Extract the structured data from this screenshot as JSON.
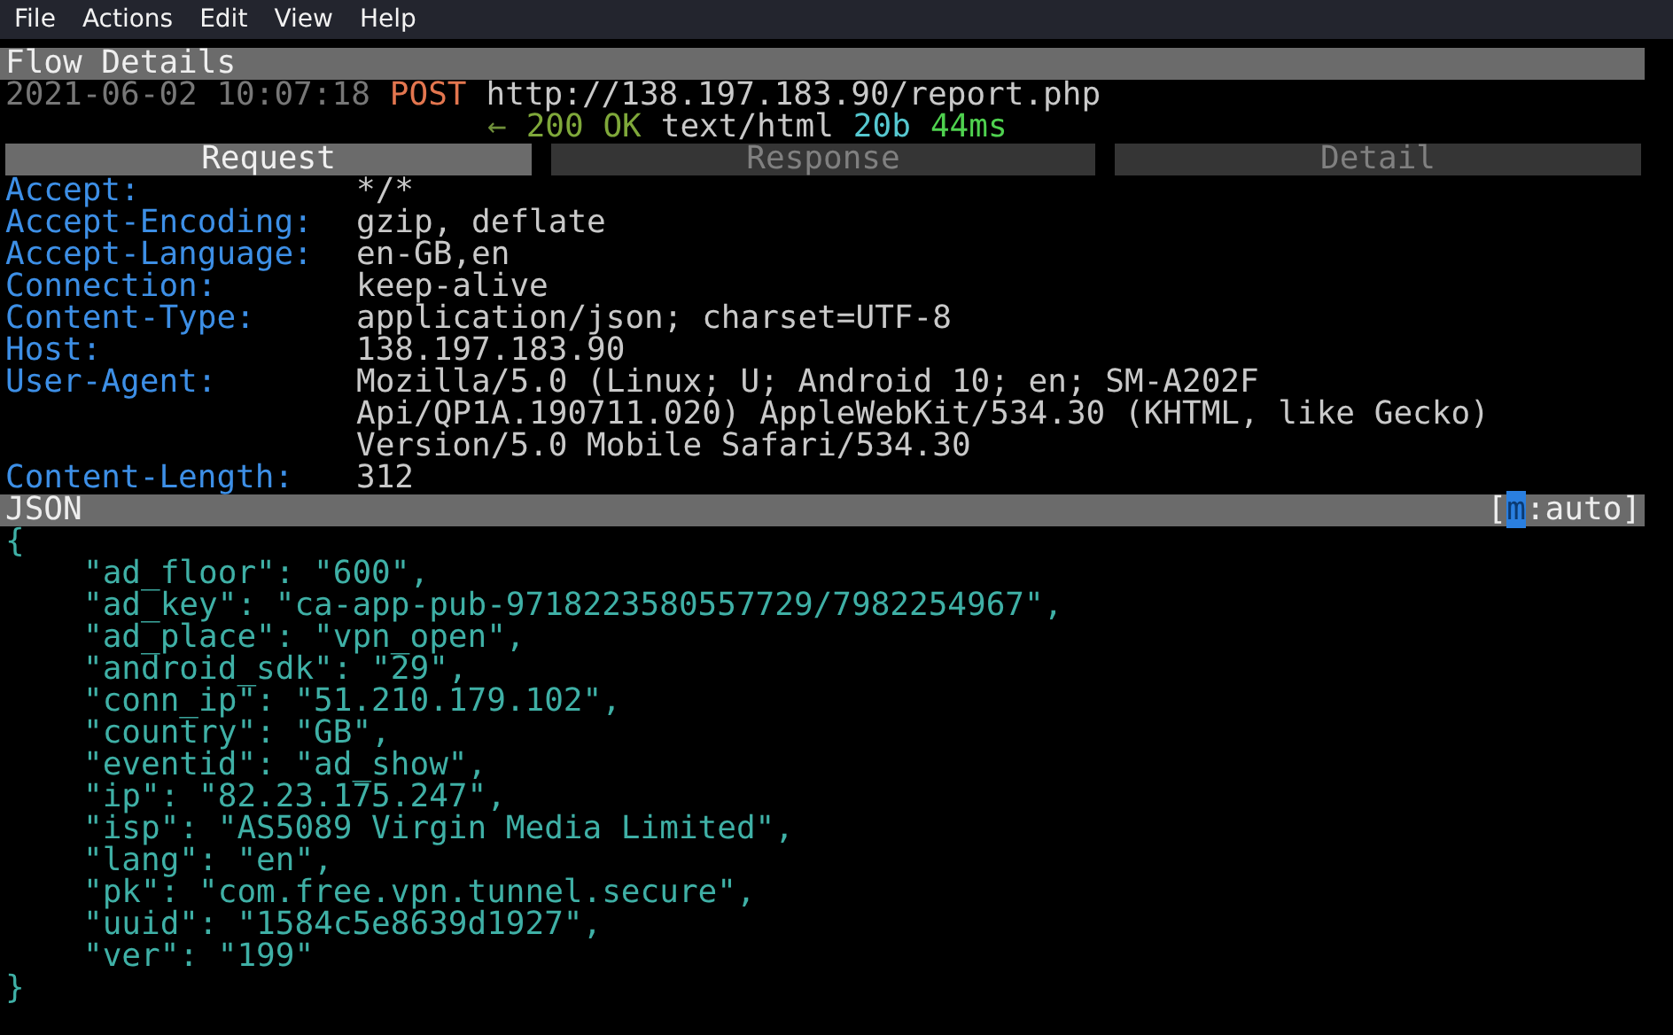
{
  "menu": [
    "File",
    "Actions",
    "Edit",
    "View",
    "Help"
  ],
  "flow": {
    "title": "Flow Details",
    "timestamp": "2021-06-02 10:07:18",
    "method": "POST",
    "url": "http://138.197.183.90/report.php",
    "response": {
      "arrow": "←",
      "status": "200 OK",
      "content_type": "text/html",
      "size": "20b",
      "time": "44ms"
    }
  },
  "tabs": [
    {
      "label": "Request",
      "selected": true
    },
    {
      "label": "Response",
      "selected": false
    },
    {
      "label": "Detail",
      "selected": false
    }
  ],
  "headers": [
    {
      "name": "Accept:",
      "value": [
        "*/*"
      ]
    },
    {
      "name": "Accept-Encoding:",
      "value": [
        "gzip, deflate"
      ]
    },
    {
      "name": "Accept-Language:",
      "value": [
        "en-GB,en"
      ]
    },
    {
      "name": "Connection:",
      "value": [
        "keep-alive"
      ]
    },
    {
      "name": "Content-Type:",
      "value": [
        "application/json; charset=UTF-8"
      ]
    },
    {
      "name": "Host:",
      "value": [
        "138.197.183.90"
      ]
    },
    {
      "name": "User-Agent:",
      "value": [
        "Mozilla/5.0 (Linux; U; Android 10; en; SM-A202F",
        "Api/QP1A.190711.020) AppleWebKit/534.30 (KHTML, like Gecko)",
        "Version/5.0 Mobile Safari/534.30"
      ]
    },
    {
      "name": "Content-Length:",
      "value": [
        "312"
      ]
    }
  ],
  "body": {
    "title": "JSON",
    "mode_open": "[",
    "mode_key": "m",
    "mode": ":auto]",
    "open": "{",
    "lines": [
      "\"ad_floor\": \"600\",",
      "\"ad_key\": \"ca-app-pub-9718223580557729/7982254967\",",
      "\"ad_place\": \"vpn_open\",",
      "\"android_sdk\": \"29\",",
      "\"conn_ip\": \"51.210.179.102\",",
      "\"country\": \"GB\",",
      "\"eventid\": \"ad_show\",",
      "\"ip\": \"82.23.175.247\",",
      "\"isp\": \"AS5089 Virgin Media Limited\",",
      "\"lang\": \"en\",",
      "\"pk\": \"com.free.vpn.tunnel.secure\",",
      "\"uuid\": \"1584c5e8639d1927\",",
      "\"ver\": \"199\""
    ],
    "close": "}"
  }
}
